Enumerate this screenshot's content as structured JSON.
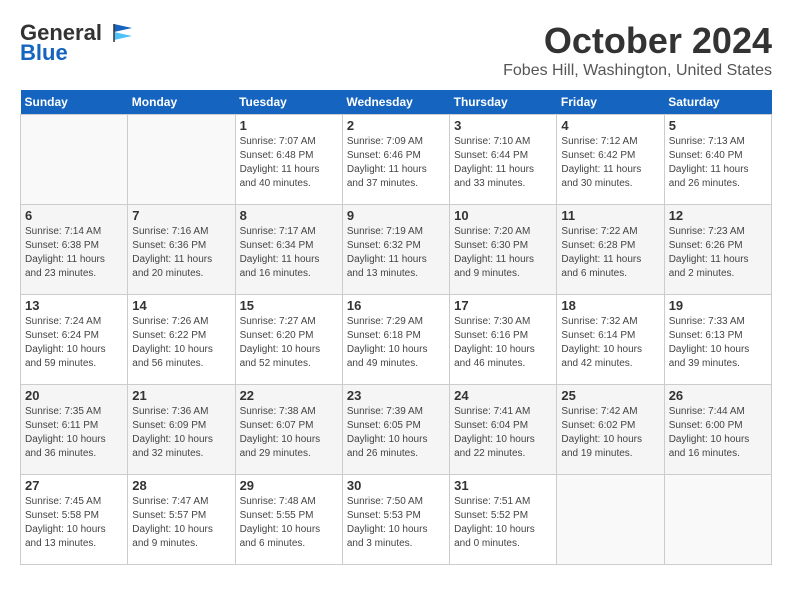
{
  "header": {
    "logo_general": "General",
    "logo_blue": "Blue",
    "month_title": "October 2024",
    "location": "Fobes Hill, Washington, United States"
  },
  "weekdays": [
    "Sunday",
    "Monday",
    "Tuesday",
    "Wednesday",
    "Thursday",
    "Friday",
    "Saturday"
  ],
  "weeks": [
    [
      {
        "day": "",
        "info": ""
      },
      {
        "day": "",
        "info": ""
      },
      {
        "day": "1",
        "info": "Sunrise: 7:07 AM\nSunset: 6:48 PM\nDaylight: 11 hours and 40 minutes."
      },
      {
        "day": "2",
        "info": "Sunrise: 7:09 AM\nSunset: 6:46 PM\nDaylight: 11 hours and 37 minutes."
      },
      {
        "day": "3",
        "info": "Sunrise: 7:10 AM\nSunset: 6:44 PM\nDaylight: 11 hours and 33 minutes."
      },
      {
        "day": "4",
        "info": "Sunrise: 7:12 AM\nSunset: 6:42 PM\nDaylight: 11 hours and 30 minutes."
      },
      {
        "day": "5",
        "info": "Sunrise: 7:13 AM\nSunset: 6:40 PM\nDaylight: 11 hours and 26 minutes."
      }
    ],
    [
      {
        "day": "6",
        "info": "Sunrise: 7:14 AM\nSunset: 6:38 PM\nDaylight: 11 hours and 23 minutes."
      },
      {
        "day": "7",
        "info": "Sunrise: 7:16 AM\nSunset: 6:36 PM\nDaylight: 11 hours and 20 minutes."
      },
      {
        "day": "8",
        "info": "Sunrise: 7:17 AM\nSunset: 6:34 PM\nDaylight: 11 hours and 16 minutes."
      },
      {
        "day": "9",
        "info": "Sunrise: 7:19 AM\nSunset: 6:32 PM\nDaylight: 11 hours and 13 minutes."
      },
      {
        "day": "10",
        "info": "Sunrise: 7:20 AM\nSunset: 6:30 PM\nDaylight: 11 hours and 9 minutes."
      },
      {
        "day": "11",
        "info": "Sunrise: 7:22 AM\nSunset: 6:28 PM\nDaylight: 11 hours and 6 minutes."
      },
      {
        "day": "12",
        "info": "Sunrise: 7:23 AM\nSunset: 6:26 PM\nDaylight: 11 hours and 2 minutes."
      }
    ],
    [
      {
        "day": "13",
        "info": "Sunrise: 7:24 AM\nSunset: 6:24 PM\nDaylight: 10 hours and 59 minutes."
      },
      {
        "day": "14",
        "info": "Sunrise: 7:26 AM\nSunset: 6:22 PM\nDaylight: 10 hours and 56 minutes."
      },
      {
        "day": "15",
        "info": "Sunrise: 7:27 AM\nSunset: 6:20 PM\nDaylight: 10 hours and 52 minutes."
      },
      {
        "day": "16",
        "info": "Sunrise: 7:29 AM\nSunset: 6:18 PM\nDaylight: 10 hours and 49 minutes."
      },
      {
        "day": "17",
        "info": "Sunrise: 7:30 AM\nSunset: 6:16 PM\nDaylight: 10 hours and 46 minutes."
      },
      {
        "day": "18",
        "info": "Sunrise: 7:32 AM\nSunset: 6:14 PM\nDaylight: 10 hours and 42 minutes."
      },
      {
        "day": "19",
        "info": "Sunrise: 7:33 AM\nSunset: 6:13 PM\nDaylight: 10 hours and 39 minutes."
      }
    ],
    [
      {
        "day": "20",
        "info": "Sunrise: 7:35 AM\nSunset: 6:11 PM\nDaylight: 10 hours and 36 minutes."
      },
      {
        "day": "21",
        "info": "Sunrise: 7:36 AM\nSunset: 6:09 PM\nDaylight: 10 hours and 32 minutes."
      },
      {
        "day": "22",
        "info": "Sunrise: 7:38 AM\nSunset: 6:07 PM\nDaylight: 10 hours and 29 minutes."
      },
      {
        "day": "23",
        "info": "Sunrise: 7:39 AM\nSunset: 6:05 PM\nDaylight: 10 hours and 26 minutes."
      },
      {
        "day": "24",
        "info": "Sunrise: 7:41 AM\nSunset: 6:04 PM\nDaylight: 10 hours and 22 minutes."
      },
      {
        "day": "25",
        "info": "Sunrise: 7:42 AM\nSunset: 6:02 PM\nDaylight: 10 hours and 19 minutes."
      },
      {
        "day": "26",
        "info": "Sunrise: 7:44 AM\nSunset: 6:00 PM\nDaylight: 10 hours and 16 minutes."
      }
    ],
    [
      {
        "day": "27",
        "info": "Sunrise: 7:45 AM\nSunset: 5:58 PM\nDaylight: 10 hours and 13 minutes."
      },
      {
        "day": "28",
        "info": "Sunrise: 7:47 AM\nSunset: 5:57 PM\nDaylight: 10 hours and 9 minutes."
      },
      {
        "day": "29",
        "info": "Sunrise: 7:48 AM\nSunset: 5:55 PM\nDaylight: 10 hours and 6 minutes."
      },
      {
        "day": "30",
        "info": "Sunrise: 7:50 AM\nSunset: 5:53 PM\nDaylight: 10 hours and 3 minutes."
      },
      {
        "day": "31",
        "info": "Sunrise: 7:51 AM\nSunset: 5:52 PM\nDaylight: 10 hours and 0 minutes."
      },
      {
        "day": "",
        "info": ""
      },
      {
        "day": "",
        "info": ""
      }
    ]
  ]
}
